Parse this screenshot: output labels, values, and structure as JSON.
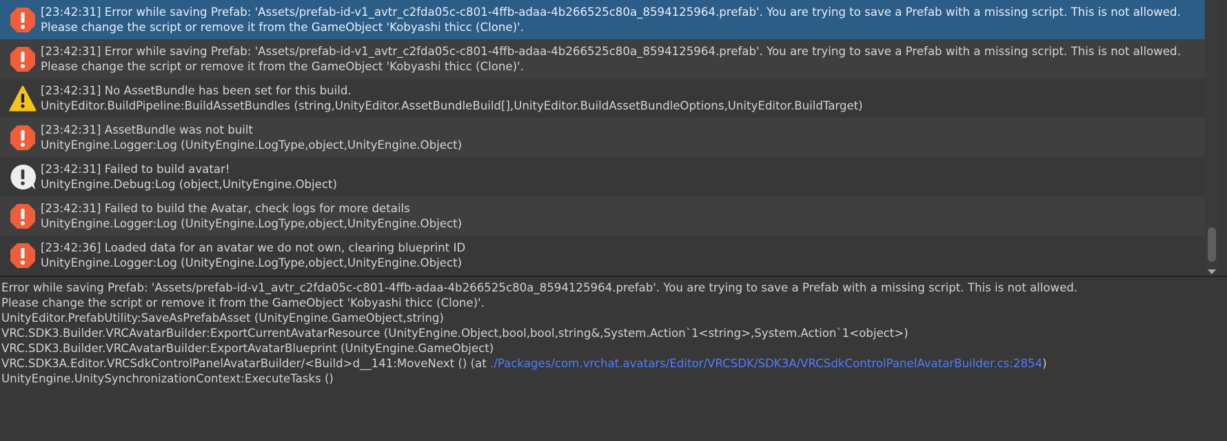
{
  "logs": [
    {
      "type": "error",
      "icon": "error-icon",
      "selected": true,
      "line1": "[23:42:31] Error while saving Prefab: 'Assets/prefab-id-v1_avtr_c2fda05c-c801-4ffb-adaa-4b266525c80a_8594125964.prefab'. You are trying to save a Prefab with a missing script. This is not allowed.",
      "line2": "Please change the script or remove it from the GameObject 'Kobyashi thicc (Clone)'."
    },
    {
      "type": "error",
      "icon": "error-icon",
      "selected": false,
      "line1": "[23:42:31] Error while saving Prefab: 'Assets/prefab-id-v1_avtr_c2fda05c-c801-4ffb-adaa-4b266525c80a_8594125964.prefab'. You are trying to save a Prefab with a missing script. This is not allowed.",
      "line2": "Please change the script or remove it from the GameObject 'Kobyashi thicc (Clone)'."
    },
    {
      "type": "warning",
      "icon": "warning-icon",
      "selected": false,
      "line1": "[23:42:31] No AssetBundle has been set for this build.",
      "line2": "UnityEditor.BuildPipeline:BuildAssetBundles (string,UnityEditor.AssetBundleBuild[],UnityEditor.BuildAssetBundleOptions,UnityEditor.BuildTarget)"
    },
    {
      "type": "error",
      "icon": "error-icon",
      "selected": false,
      "line1": "[23:42:31] AssetBundle was not built",
      "line2": "UnityEngine.Logger:Log (UnityEngine.LogType,object,UnityEngine.Object)"
    },
    {
      "type": "info",
      "icon": "info-icon",
      "selected": false,
      "line1": "[23:42:31] Failed to build avatar!",
      "line2": "UnityEngine.Debug:Log (object,UnityEngine.Object)"
    },
    {
      "type": "error",
      "icon": "error-icon",
      "selected": false,
      "line1": "[23:42:31] Failed to build the Avatar, check logs for more details",
      "line2": "UnityEngine.Logger:Log (UnityEngine.LogType,object,UnityEngine.Object)"
    },
    {
      "type": "error",
      "icon": "error-icon",
      "selected": false,
      "line1": "[23:42:36] Loaded data for an avatar we do not own, clearing blueprint ID",
      "line2": "UnityEngine.Logger:Log (UnityEngine.LogType,object,UnityEngine.Object)"
    }
  ],
  "detail": {
    "line1": "Error while saving Prefab: 'Assets/prefab-id-v1_avtr_c2fda05c-c801-4ffb-adaa-4b266525c80a_8594125964.prefab'. You are trying to save a Prefab with a missing script. This is not allowed.",
    "line2": "Please change the script or remove it from the GameObject 'Kobyashi thicc (Clone)'.",
    "line3": "UnityEditor.PrefabUtility:SaveAsPrefabAsset (UnityEngine.GameObject,string)",
    "line4": "VRC.SDK3.Builder.VRCAvatarBuilder:ExportCurrentAvatarResource (UnityEngine.Object,bool,bool,string&,System.Action`1<string>,System.Action`1<object>)",
    "line5": "VRC.SDK3.Builder.VRCAvatarBuilder:ExportAvatarBlueprint (UnityEngine.GameObject)",
    "line6_prefix": "VRC.SDK3A.Editor.VRCSdkControlPanelAvatarBuilder/<Build>d__141:MoveNext () (at ",
    "line6_link": "./Packages/com.vrchat.avatars/Editor/VRCSDK/SDK3A/VRCSdkControlPanelAvatarBuilder.cs:2854",
    "line6_suffix": ")",
    "line7": "UnityEngine.UnitySynchronizationContext:ExecuteTasks ()"
  },
  "colors": {
    "selected_row": "#2c5d87",
    "error_icon": "#f05d3b",
    "warning_icon": "#f4c21a",
    "info_icon": "#ededed",
    "link": "#4c7fff"
  }
}
